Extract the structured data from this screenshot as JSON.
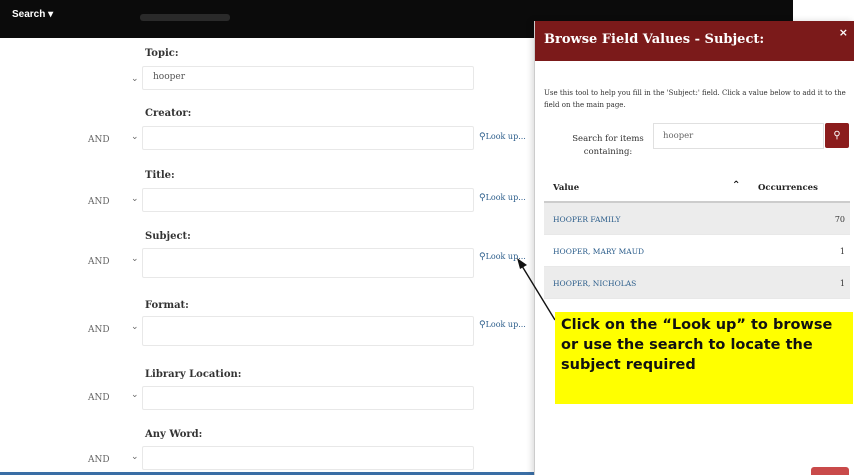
{
  "topbar": {
    "search_menu": "Search ▾"
  },
  "form": {
    "fields": [
      {
        "label": "Topic:",
        "op": "",
        "value": "hooper",
        "lookup": ""
      },
      {
        "label": "Creator:",
        "op": "AND",
        "value": "",
        "lookup": "Look up..."
      },
      {
        "label": "Title:",
        "op": "AND",
        "value": "",
        "lookup": "Look up..."
      },
      {
        "label": "Subject:",
        "op": "AND",
        "value": "",
        "lookup": "Look up..."
      },
      {
        "label": "Format:",
        "op": "AND",
        "value": "",
        "lookup": "Look up..."
      },
      {
        "label": "Library Location:",
        "op": "AND",
        "value": "",
        "lookup": ""
      },
      {
        "label": "Any Word:",
        "op": "AND",
        "value": "",
        "lookup": ""
      }
    ]
  },
  "modal": {
    "title": "Browse Field Values - Subject:",
    "close": "×",
    "help": "Use this tool to help you fill in the 'Subject:' field. Click a value below to add it to the field on the main page.",
    "search_label": "Search for items containing:",
    "search_value": "hooper",
    "table": {
      "col_value": "Value",
      "col_occurrences": "Occurrences",
      "rows": [
        {
          "value": "HOOPER FAMILY",
          "count": "70"
        },
        {
          "value": "HOOPER, MARY MAUD",
          "count": "1"
        },
        {
          "value": "HOOPER, NICHOLAS",
          "count": "1"
        }
      ]
    }
  },
  "callout": {
    "lines": [
      "Click on the “Look up” to browse",
      "or use the search to locate the",
      "subject required"
    ]
  },
  "colors": {
    "header": "#7b1a1a",
    "accent": "#8b1c1c",
    "link": "#2a5c8a",
    "callout": "#ffff00"
  }
}
